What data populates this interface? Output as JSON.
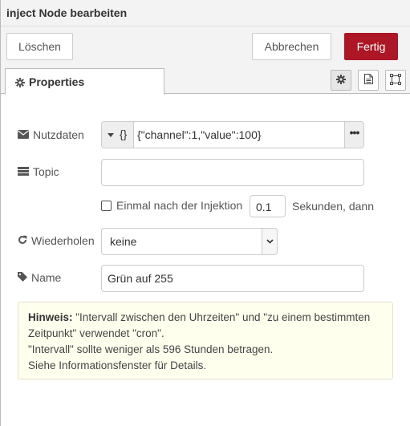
{
  "header": {
    "title": "inject Node bearbeiten"
  },
  "toolbar": {
    "delete_label": "Löschen",
    "cancel_label": "Abbrechen",
    "done_label": "Fertig",
    "accent": "#ad1625"
  },
  "tabs": {
    "properties_label": "Properties",
    "icons": [
      "gear-icon",
      "document-icon",
      "frame-icon"
    ]
  },
  "form": {
    "payload_label": "Nutzdaten",
    "payload_type_glyph": "{}",
    "payload_value": "{\"channel\":1,\"value\":100}",
    "payload_more": "•••",
    "topic_label": "Topic",
    "topic_value": "",
    "once_label": "Einmal nach der Injektion",
    "once_checked": false,
    "once_delay": "0.1",
    "seconds_label": "Sekunden, dann",
    "repeat_label": "Wiederholen",
    "repeat_value": "keine",
    "name_label": "Name",
    "name_value": "Grün auf 255"
  },
  "note": {
    "title": "Hinweis:",
    "line1": " \"Intervall zwischen den Uhrzeiten\" und \"zu einem bestimmten Zeitpunkt\" verwendet \"cron\".",
    "line2": "\"Intervall\" sollte weniger als 596 Stunden betragen.",
    "line3": "Siehe Informationsfenster für Details."
  }
}
